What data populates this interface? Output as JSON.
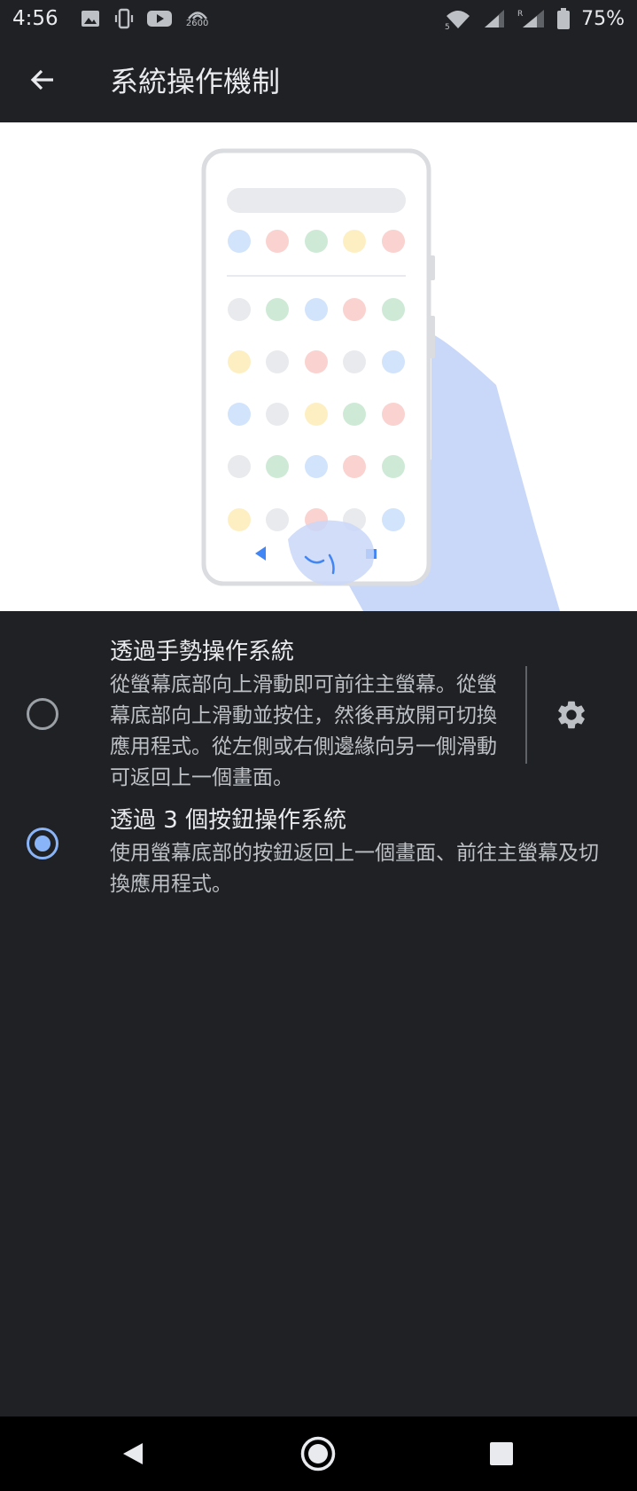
{
  "status_bar": {
    "time": "4:56",
    "left_icons": [
      "image-icon",
      "vibrate-icon",
      "youtube-icon",
      "network-speed-icon"
    ],
    "network_badge": "2600",
    "right_icons": [
      "wifi-icon",
      "signal-icon",
      "signal-roaming-icon",
      "battery-icon"
    ],
    "battery": "75%"
  },
  "app_bar": {
    "title": "系統操作機制",
    "back_icon": "arrow-back-icon"
  },
  "options": [
    {
      "title": "透過手勢操作系統",
      "description": "從螢幕底部向上滑動即可前往主螢幕。從螢幕底部向上滑動並按住，然後再放開可切換應用程式。從左側或右側邊緣向另一側滑動可返回上一個畫面。",
      "selected": false,
      "settings_icon": "gear-icon"
    },
    {
      "title": "透過 3 個按鈕操作系統",
      "description": "使用螢幕底部的按鈕返回上一個畫面、前往主螢幕及切換應用程式。",
      "selected": true
    }
  ],
  "nav_bar": {
    "buttons": [
      "back-triangle-icon",
      "home-circle-icon",
      "recents-square-icon"
    ]
  },
  "colors": {
    "background": "#202124",
    "accent": "#8ab4f8",
    "text_primary": "#e8eaed",
    "text_secondary": "#bdc1c6"
  }
}
